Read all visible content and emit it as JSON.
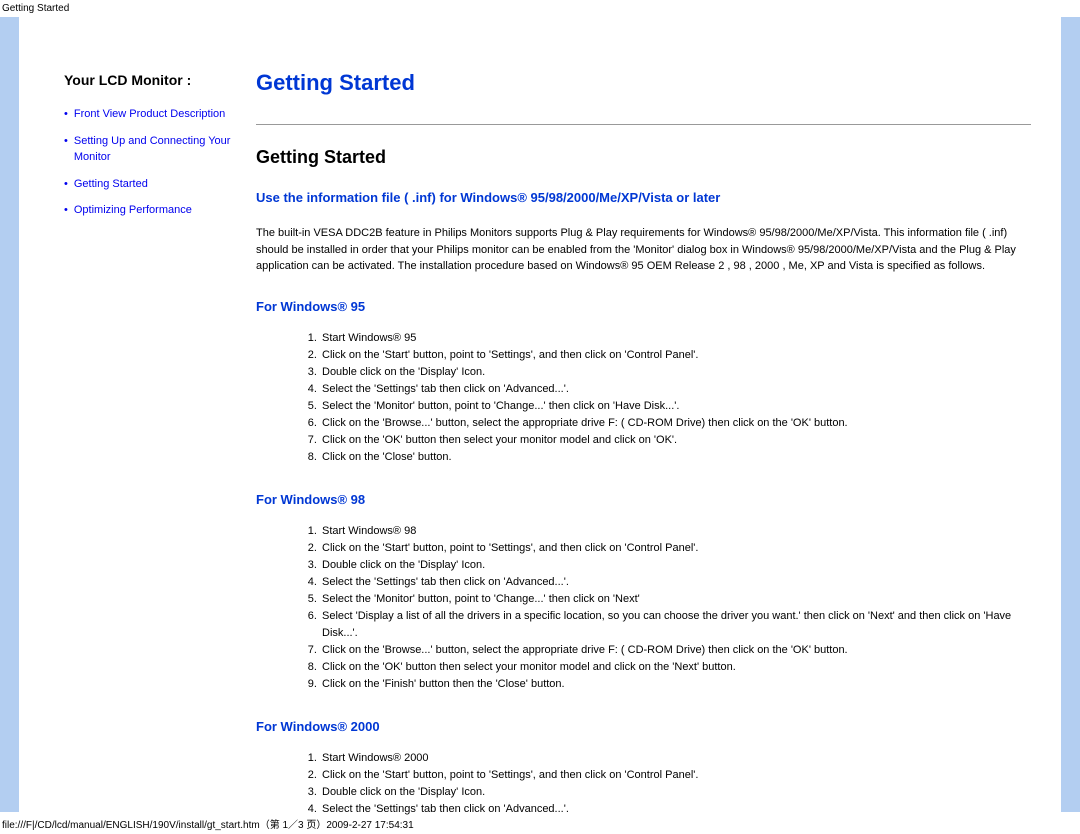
{
  "header": {
    "title": "Getting Started"
  },
  "sidebar": {
    "heading": "Your LCD Monitor :",
    "items": [
      "Front View Product Description",
      "Setting Up and Connecting Your Monitor",
      "Getting Started",
      "Optimizing Performance"
    ]
  },
  "main": {
    "title": "Getting Started",
    "subtitle": "Getting Started",
    "inf_title": "Use the information file ( .inf) for Windows® 95/98/2000/Me/XP/Vista or later",
    "paragraph": "The built-in VESA DDC2B feature in Philips Monitors supports Plug & Play requirements for Windows® 95/98/2000/Me/XP/Vista. This information file ( .inf) should be installed in order that your Philips monitor can be enabled from the 'Monitor' dialog box in Windows® 95/98/2000/Me/XP/Vista and the Plug & Play application can be activated. The installation procedure based on Windows® 95 OEM Release 2 , 98 , 2000 , Me, XP and Vista is specified as follows.",
    "sections": [
      {
        "heading": "For Windows® 95",
        "steps": [
          "Start Windows® 95",
          "Click on the 'Start' button, point to 'Settings', and then click on 'Control Panel'.",
          "Double click on the 'Display' Icon.",
          "Select the 'Settings' tab then click on 'Advanced...'.",
          "Select the 'Monitor' button, point to 'Change...' then click on 'Have Disk...'.",
          "Click on the 'Browse...' button, select the appropriate drive F: ( CD-ROM Drive) then click on the 'OK' button.",
          "Click on the 'OK' button then select your monitor model and click on 'OK'.",
          "Click on the 'Close' button."
        ]
      },
      {
        "heading": "For Windows® 98",
        "steps": [
          "Start Windows® 98",
          "Click on the 'Start' button, point to 'Settings', and then click on 'Control Panel'.",
          "Double click on the 'Display' Icon.",
          "Select the 'Settings' tab then click on 'Advanced...'.",
          "Select the 'Monitor' button, point to 'Change...' then click on 'Next'",
          "Select 'Display a list of all the drivers in a specific location, so you can choose the driver you want.' then click on 'Next' and then click on 'Have Disk...'.",
          "Click on the 'Browse...' button, select the appropriate drive F: ( CD-ROM Drive) then click on the 'OK' button.",
          "Click on the 'OK' button then select your monitor model and click on the 'Next' button.",
          "Click on the 'Finish' button then the 'Close' button."
        ]
      },
      {
        "heading": "For Windows® 2000",
        "steps": [
          "Start Windows® 2000",
          "Click on the 'Start' button, point to 'Settings', and then click on 'Control Panel'.",
          "Double click on the 'Display' Icon.",
          "Select the 'Settings' tab then click on 'Advanced...'."
        ]
      }
    ]
  },
  "footer": {
    "text": "file:///F|/CD/lcd/manual/ENGLISH/190V/install/gt_start.htm（第 1／3 页）2009-2-27 17:54:31"
  }
}
